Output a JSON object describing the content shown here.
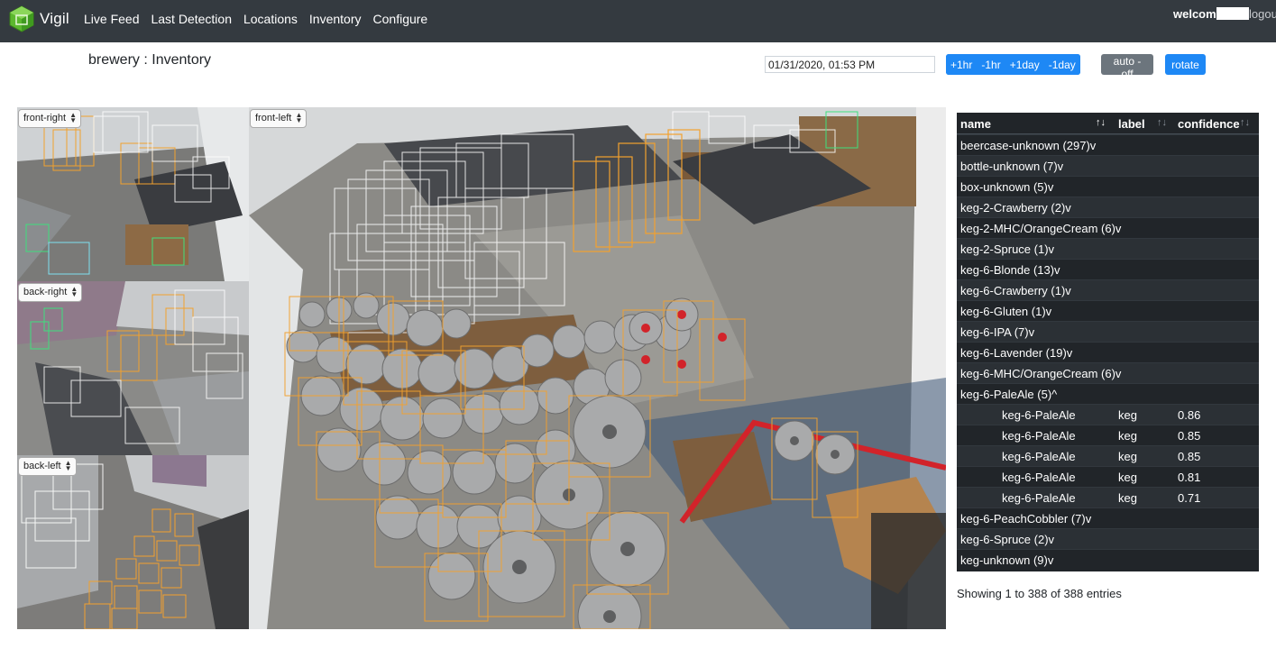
{
  "nav": {
    "brand": "Vigil",
    "links": [
      "Live Feed",
      "Last Detection",
      "Locations",
      "Inventory",
      "Configure"
    ],
    "welcome": "welcome",
    "logout": "logout"
  },
  "page": {
    "title": "brewery : Inventory"
  },
  "controls": {
    "datetime": "01/31/2020, 01:53 PM",
    "time_buttons": [
      "+1hr",
      "-1hr",
      "+1day",
      "-1day"
    ],
    "auto": "auto - off",
    "rotate": "rotate"
  },
  "cameras": {
    "front_right": "front-right",
    "back_right": "back-right",
    "back_left": "back-left",
    "front_left": "front-left"
  },
  "table": {
    "headers": {
      "name": "name",
      "label": "label",
      "confidence": "confidence"
    },
    "rows": [
      {
        "name": "beercase-unknown (297)v",
        "label": "",
        "confidence": ""
      },
      {
        "name": "bottle-unknown (7)v",
        "label": "",
        "confidence": ""
      },
      {
        "name": "box-unknown (5)v",
        "label": "",
        "confidence": ""
      },
      {
        "name": "keg-2-Crawberry (2)v",
        "label": "",
        "confidence": ""
      },
      {
        "name": "keg-2-MHC/OrangeCream (6)v",
        "label": "",
        "confidence": ""
      },
      {
        "name": "keg-2-Spruce (1)v",
        "label": "",
        "confidence": ""
      },
      {
        "name": "keg-6-Blonde (13)v",
        "label": "",
        "confidence": ""
      },
      {
        "name": "keg-6-Crawberry (1)v",
        "label": "",
        "confidence": ""
      },
      {
        "name": "keg-6-Gluten (1)v",
        "label": "",
        "confidence": ""
      },
      {
        "name": "keg-6-IPA (7)v",
        "label": "",
        "confidence": ""
      },
      {
        "name": "keg-6-Lavender (19)v",
        "label": "",
        "confidence": ""
      },
      {
        "name": "keg-6-MHC/OrangeCream (6)v",
        "label": "",
        "confidence": ""
      },
      {
        "name": "keg-6-PaleAle (5)^",
        "label": "",
        "confidence": ""
      },
      {
        "name": "keg-6-PaleAle",
        "label": "keg",
        "confidence": "0.86"
      },
      {
        "name": "keg-6-PaleAle",
        "label": "keg",
        "confidence": "0.85"
      },
      {
        "name": "keg-6-PaleAle",
        "label": "keg",
        "confidence": "0.85"
      },
      {
        "name": "keg-6-PaleAle",
        "label": "keg",
        "confidence": "0.81"
      },
      {
        "name": "keg-6-PaleAle",
        "label": "keg",
        "confidence": "0.71"
      },
      {
        "name": "keg-6-PeachCobbler (7)v",
        "label": "",
        "confidence": ""
      },
      {
        "name": "keg-6-Spruce (2)v",
        "label": "",
        "confidence": ""
      },
      {
        "name": "keg-unknown (9)v",
        "label": "",
        "confidence": ""
      }
    ],
    "info": "Showing 1 to 388 of 388 entries"
  },
  "colors": {
    "navbar": "#343a40",
    "primary": "#1e88f5",
    "secondary": "#6c757d",
    "table_bg": "#212529",
    "detection_keg": "#f2a12e",
    "detection_case": "#ffffff"
  }
}
